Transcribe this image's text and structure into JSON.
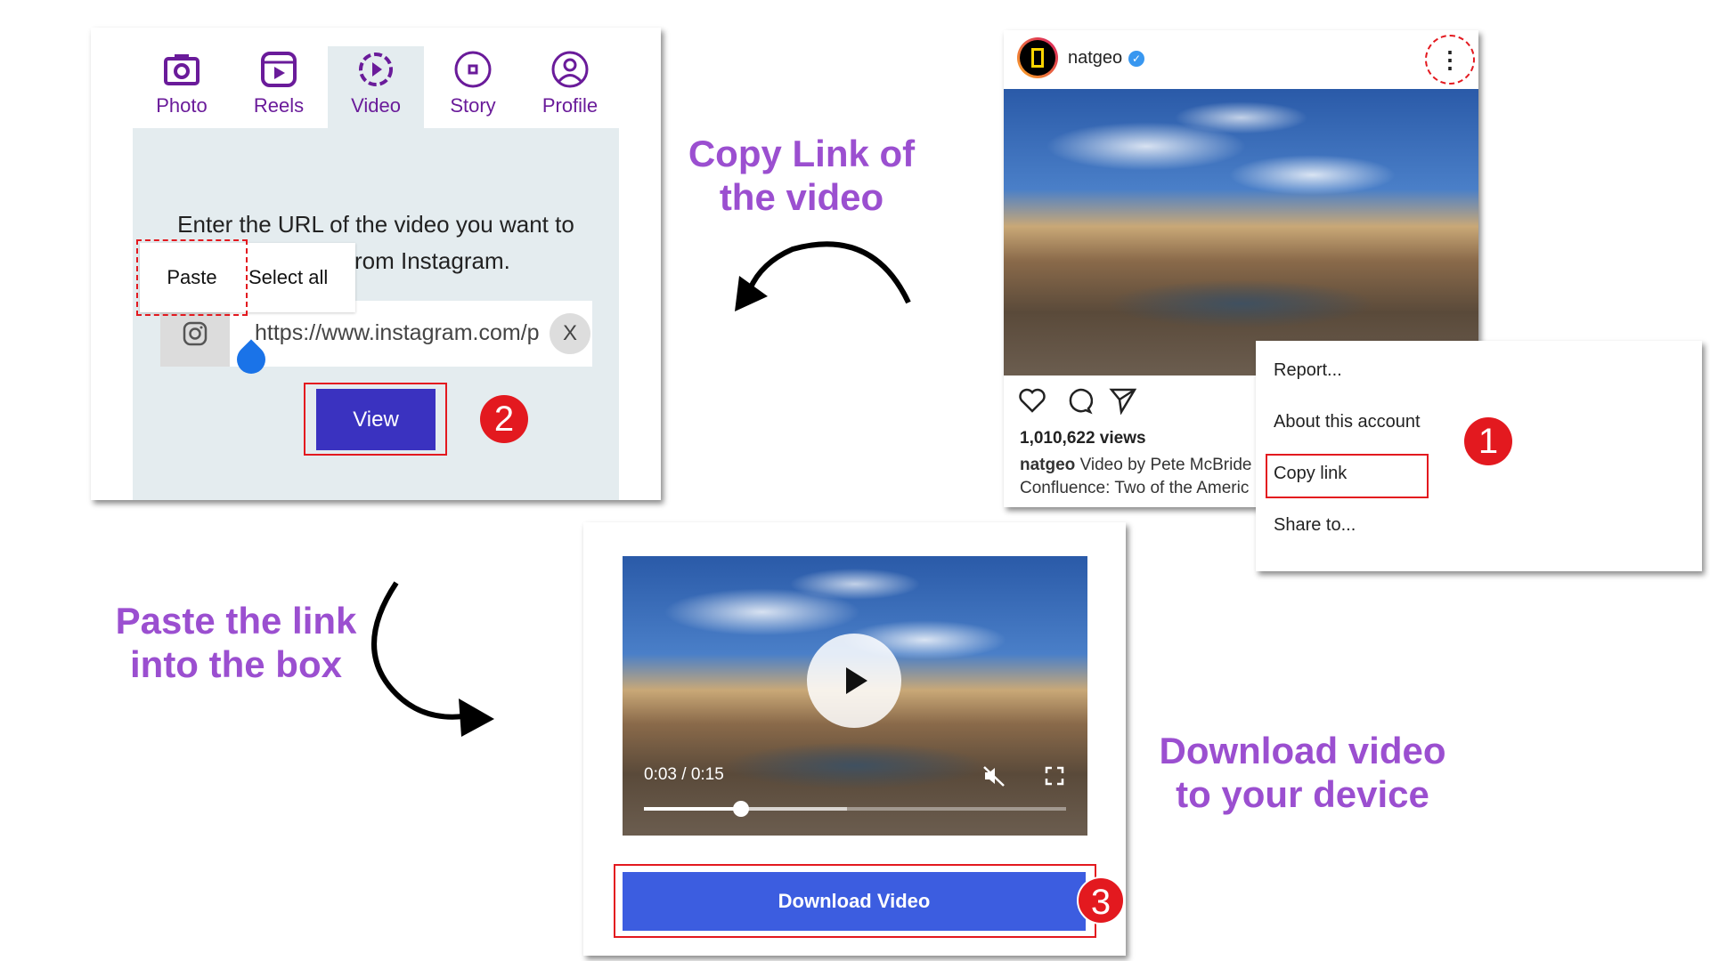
{
  "downloader": {
    "tabs": [
      {
        "label": "Photo",
        "icon": "camera-icon"
      },
      {
        "label": "Reels",
        "icon": "reels-icon"
      },
      {
        "label": "Video",
        "icon": "video-play-icon",
        "active": true
      },
      {
        "label": "Story",
        "icon": "story-icon"
      },
      {
        "label": "Profile",
        "icon": "profile-icon"
      }
    ],
    "instruction_line1": "Enter the URL of the video you want to",
    "instruction_line2": "rom Instagram.",
    "context_menu": {
      "paste": "Paste",
      "select_all": "Select all"
    },
    "url_value": "https://www.instagram.com/p",
    "clear_label": "X",
    "view_label": "View",
    "step_badge": "2"
  },
  "notes": {
    "copy_link_line1": "Copy Link of",
    "copy_link_line2": "the video",
    "paste_line1": "Paste the link",
    "paste_line2": "into the box",
    "download_line1": "Download video",
    "download_line2": "to your device"
  },
  "instagram_post": {
    "username": "natgeo",
    "verified": true,
    "views": "1,010,622 views",
    "caption_user": "natgeo",
    "caption_text": "Video by Pete McBride",
    "caption_line2": "Confluence: Two of the Americ",
    "menu": [
      "Report...",
      "About this account",
      "Copy link",
      "Share to..."
    ],
    "step_badge": "1"
  },
  "player": {
    "time": "0:03 / 0:15",
    "progress": 0.23,
    "buffered": 0.48,
    "muted": true,
    "download_label": "Download Video",
    "step_badge": "3"
  },
  "colors": {
    "accent_purple": "#6a1b9a",
    "note_purple": "#9b4fd0",
    "view_button": "#3a32c0",
    "download_button": "#3c5de0",
    "highlight_red": "#e3191f"
  }
}
